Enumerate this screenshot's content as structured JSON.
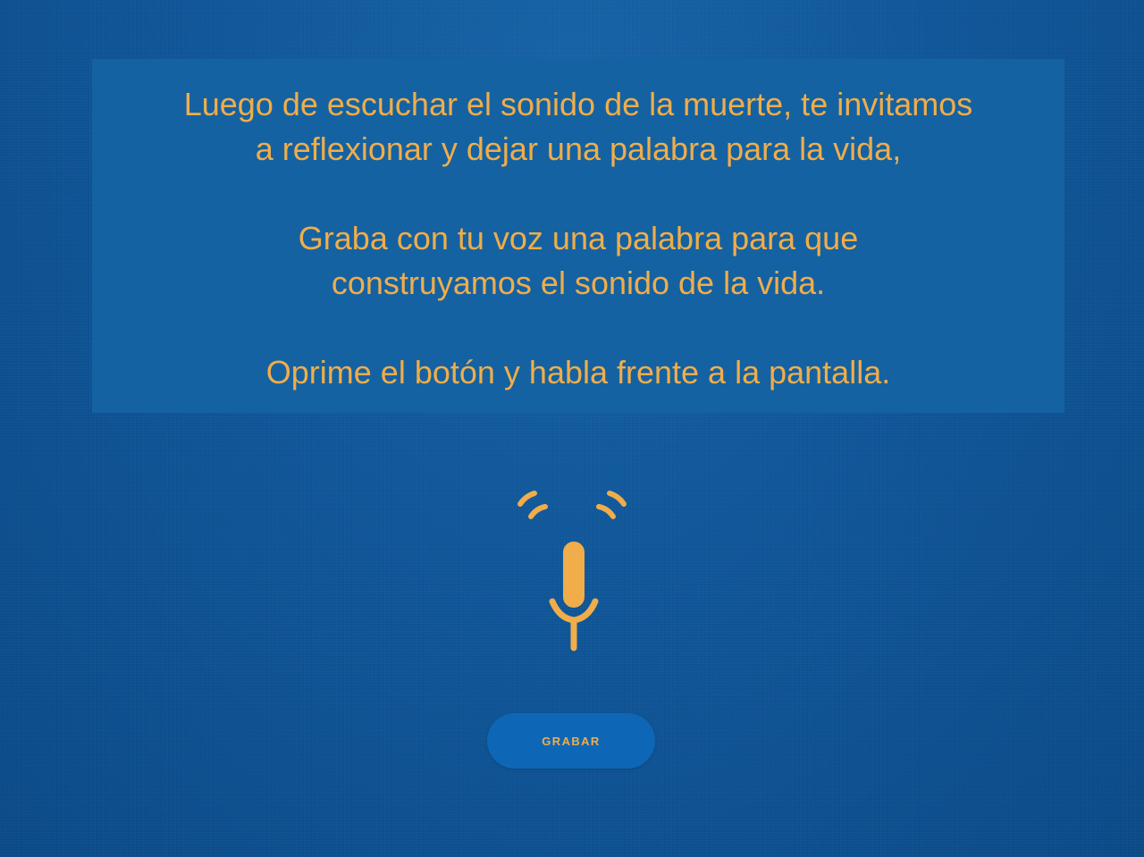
{
  "message": {
    "line1": "Luego de escuchar el sonido de la muerte, te invitamos",
    "line2": "a reflexionar y dejar una palabra para la vida,",
    "line3": "Graba con tu voz una palabra para que",
    "line4": "construyamos el sonido de la vida.",
    "line5": "Oprime el botón y habla frente a la pantalla."
  },
  "icons": {
    "microphone": "microphone-icon"
  },
  "record_button": {
    "label": "GRABAR"
  },
  "colors": {
    "background": "#0f5699",
    "panel": "#1462a2",
    "accent": "#f0ad4a",
    "button": "#0e67b6"
  }
}
